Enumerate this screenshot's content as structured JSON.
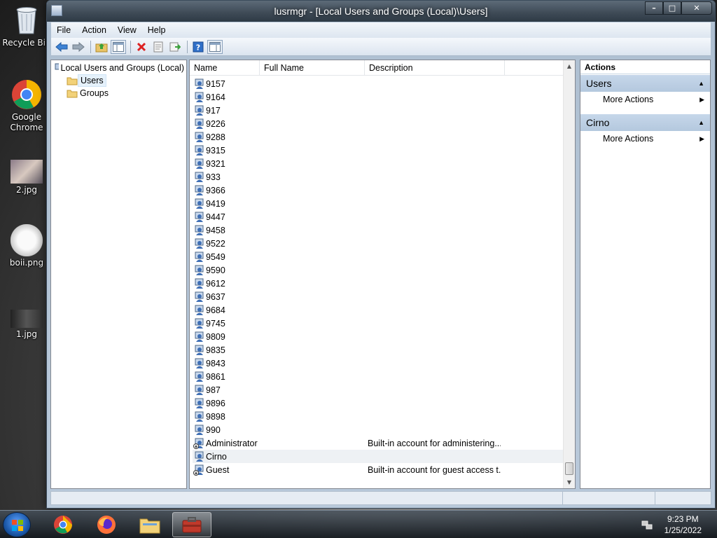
{
  "desktop": {
    "icons": [
      {
        "label": "Recycle Bin"
      },
      {
        "label": "Google Chrome"
      },
      {
        "label": "2.jpg"
      },
      {
        "label": "boii.png"
      },
      {
        "label": "1.jpg"
      }
    ]
  },
  "window": {
    "title": "lusrmgr - [Local Users and Groups (Local)\\Users]",
    "menu": [
      "File",
      "Action",
      "View",
      "Help"
    ],
    "toolbar_icons": [
      "back-icon",
      "forward-icon",
      "up-folder-icon",
      "show-hide-tree-icon",
      "delete-icon",
      "properties-icon",
      "export-list-icon",
      "help-icon",
      "show-hide-action-pane-icon"
    ]
  },
  "tree": {
    "root": "Local Users and Groups (Local)",
    "children": [
      "Users",
      "Groups"
    ],
    "selected": "Users"
  },
  "list": {
    "columns": [
      "Name",
      "Full Name",
      "Description"
    ],
    "rows": [
      {
        "name": "9157",
        "full_name": "",
        "description": ""
      },
      {
        "name": "9164",
        "full_name": "",
        "description": ""
      },
      {
        "name": "917",
        "full_name": "",
        "description": ""
      },
      {
        "name": "9226",
        "full_name": "",
        "description": ""
      },
      {
        "name": "9288",
        "full_name": "",
        "description": ""
      },
      {
        "name": "9315",
        "full_name": "",
        "description": ""
      },
      {
        "name": "9321",
        "full_name": "",
        "description": ""
      },
      {
        "name": "933",
        "full_name": "",
        "description": ""
      },
      {
        "name": "9366",
        "full_name": "",
        "description": ""
      },
      {
        "name": "9419",
        "full_name": "",
        "description": ""
      },
      {
        "name": "9447",
        "full_name": "",
        "description": ""
      },
      {
        "name": "9458",
        "full_name": "",
        "description": ""
      },
      {
        "name": "9522",
        "full_name": "",
        "description": ""
      },
      {
        "name": "9549",
        "full_name": "",
        "description": ""
      },
      {
        "name": "9590",
        "full_name": "",
        "description": ""
      },
      {
        "name": "9612",
        "full_name": "",
        "description": ""
      },
      {
        "name": "9637",
        "full_name": "",
        "description": ""
      },
      {
        "name": "9684",
        "full_name": "",
        "description": ""
      },
      {
        "name": "9745",
        "full_name": "",
        "description": ""
      },
      {
        "name": "9809",
        "full_name": "",
        "description": ""
      },
      {
        "name": "9835",
        "full_name": "",
        "description": ""
      },
      {
        "name": "9843",
        "full_name": "",
        "description": ""
      },
      {
        "name": "9861",
        "full_name": "",
        "description": ""
      },
      {
        "name": "987",
        "full_name": "",
        "description": ""
      },
      {
        "name": "9896",
        "full_name": "",
        "description": ""
      },
      {
        "name": "9898",
        "full_name": "",
        "description": ""
      },
      {
        "name": "990",
        "full_name": "",
        "description": ""
      },
      {
        "name": "Administrator",
        "full_name": "",
        "description": "Built-in account for administering...",
        "disabled": true
      },
      {
        "name": "Cirno",
        "full_name": "",
        "description": "",
        "hover": true
      },
      {
        "name": "Guest",
        "full_name": "",
        "description": "Built-in account for guest access t...",
        "disabled": true
      }
    ]
  },
  "actions": {
    "header": "Actions",
    "sections": [
      {
        "title": "Users",
        "items": [
          "More Actions"
        ]
      },
      {
        "title": "Cirno",
        "items": [
          "More Actions"
        ]
      }
    ]
  },
  "taskbar": {
    "apps": [
      "google-chrome-icon",
      "firefox-icon",
      "file-explorer-icon",
      "computer-management-icon"
    ],
    "time": "9:23 PM",
    "date": "1/25/2022"
  },
  "colors": {
    "selection": "#e5f1fb",
    "action_section": "#c6d7ea",
    "user_icon_blue": "#3f6fb5"
  }
}
